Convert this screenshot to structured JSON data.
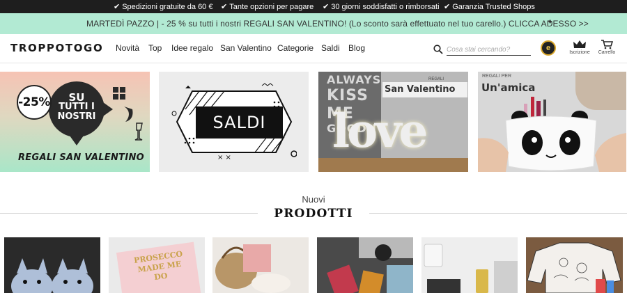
{
  "topbar": {
    "items": [
      "Spedizioni gratuite da 60 €",
      "Tante opzioni per pagare",
      "30 giorni soddisfatti o rimborsati",
      "Garanzia Trusted Shops"
    ]
  },
  "promo": {
    "text": "MARTEDÌ PAZZO | - 25 % su tutti i nostri REGALI SAN VALENTINO! (Lo sconto sarà effettuato nel tuo carello.) CLICCA ADESSO >>"
  },
  "header": {
    "logo": "TROPPOTOGO",
    "nav": [
      "Novità",
      "Top",
      "Idee regalo",
      "San Valentino",
      "Categorie",
      "Saldi",
      "Blog"
    ],
    "search_placeholder": "Cosa stai cercando?",
    "seal_label": "e",
    "signup_label": "Iscrizione",
    "cart_label": "Carrello"
  },
  "banners": {
    "b1": {
      "percent": "-25%",
      "line1": "SU",
      "line2": "TUTTI I",
      "line3": "NOSTRI",
      "title": "REGALI SAN VALENTINO"
    },
    "b2": {
      "label": "SALDI"
    },
    "b3": {
      "wall1": "ALWAYS",
      "wall2": "KISS",
      "wall3": "ME",
      "wall4": "GOODN",
      "small": "REGALI",
      "big": "San Valentino",
      "sign": "love"
    },
    "b4": {
      "small": "REGALI PER",
      "big": "Un'amica"
    }
  },
  "section": {
    "top": "Nuovi",
    "bottom": "PRODOTTI"
  },
  "products": [
    {
      "name": "product-slippers",
      "prosecco": ""
    },
    {
      "name": "product-prosecco",
      "prosecco": "PROSECCO MADE ME DO"
    },
    {
      "name": "product-bag",
      "prosecco": ""
    },
    {
      "name": "product-phonecase",
      "prosecco": ""
    },
    {
      "name": "product-powerbank",
      "prosecco": ""
    },
    {
      "name": "product-sweater",
      "prosecco": ""
    }
  ],
  "colors": {
    "topbar": "#1e1e1e",
    "promo": "#b2ead3",
    "accent": "#111111"
  }
}
